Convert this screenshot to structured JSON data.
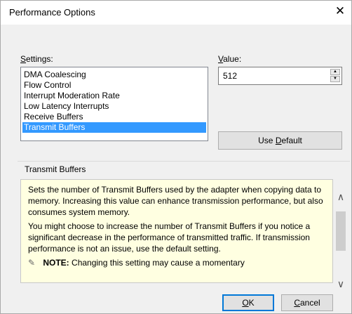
{
  "window": {
    "title": "Performance Options",
    "close_glyph": "✕"
  },
  "settings": {
    "label_prefix": "",
    "label_underlined": "S",
    "label_rest": "ettings:",
    "items": [
      "DMA Coalescing",
      "Flow Control",
      "Interrupt Moderation Rate",
      "Low Latency Interrupts",
      "Receive Buffers",
      "Transmit Buffers"
    ],
    "selected": "Transmit Buffers"
  },
  "value": {
    "label_underlined": "V",
    "label_rest": "alue:",
    "current": "512",
    "spin_up": "▲",
    "spin_down": "▼"
  },
  "use_default": {
    "label_prefix": "Use ",
    "label_underlined": "D",
    "label_rest": "efault"
  },
  "description": {
    "header": "Transmit Buffers",
    "paragraph1": "Sets the number of Transmit Buffers used by the adapter when copying data to memory. Increasing this value can enhance transmission performance, but also consumes system memory.",
    "paragraph2": "You might choose to increase the number of Transmit Buffers if you notice a significant decrease in the performance of transmitted traffic. If transmission performance is not an issue, use the default setting.",
    "note_bold": "NOTE:",
    "note_text": " Changing this setting may cause a momentary",
    "scroll_up": "∧",
    "scroll_down": "∨"
  },
  "footer": {
    "ok_underlined": "O",
    "ok_rest": "K",
    "cancel_underlined": "C",
    "cancel_rest": "ancel"
  },
  "colors": {
    "selection": "#3399ff",
    "description_bg": "#ffffe1",
    "default_button_border": "#0078d7"
  }
}
